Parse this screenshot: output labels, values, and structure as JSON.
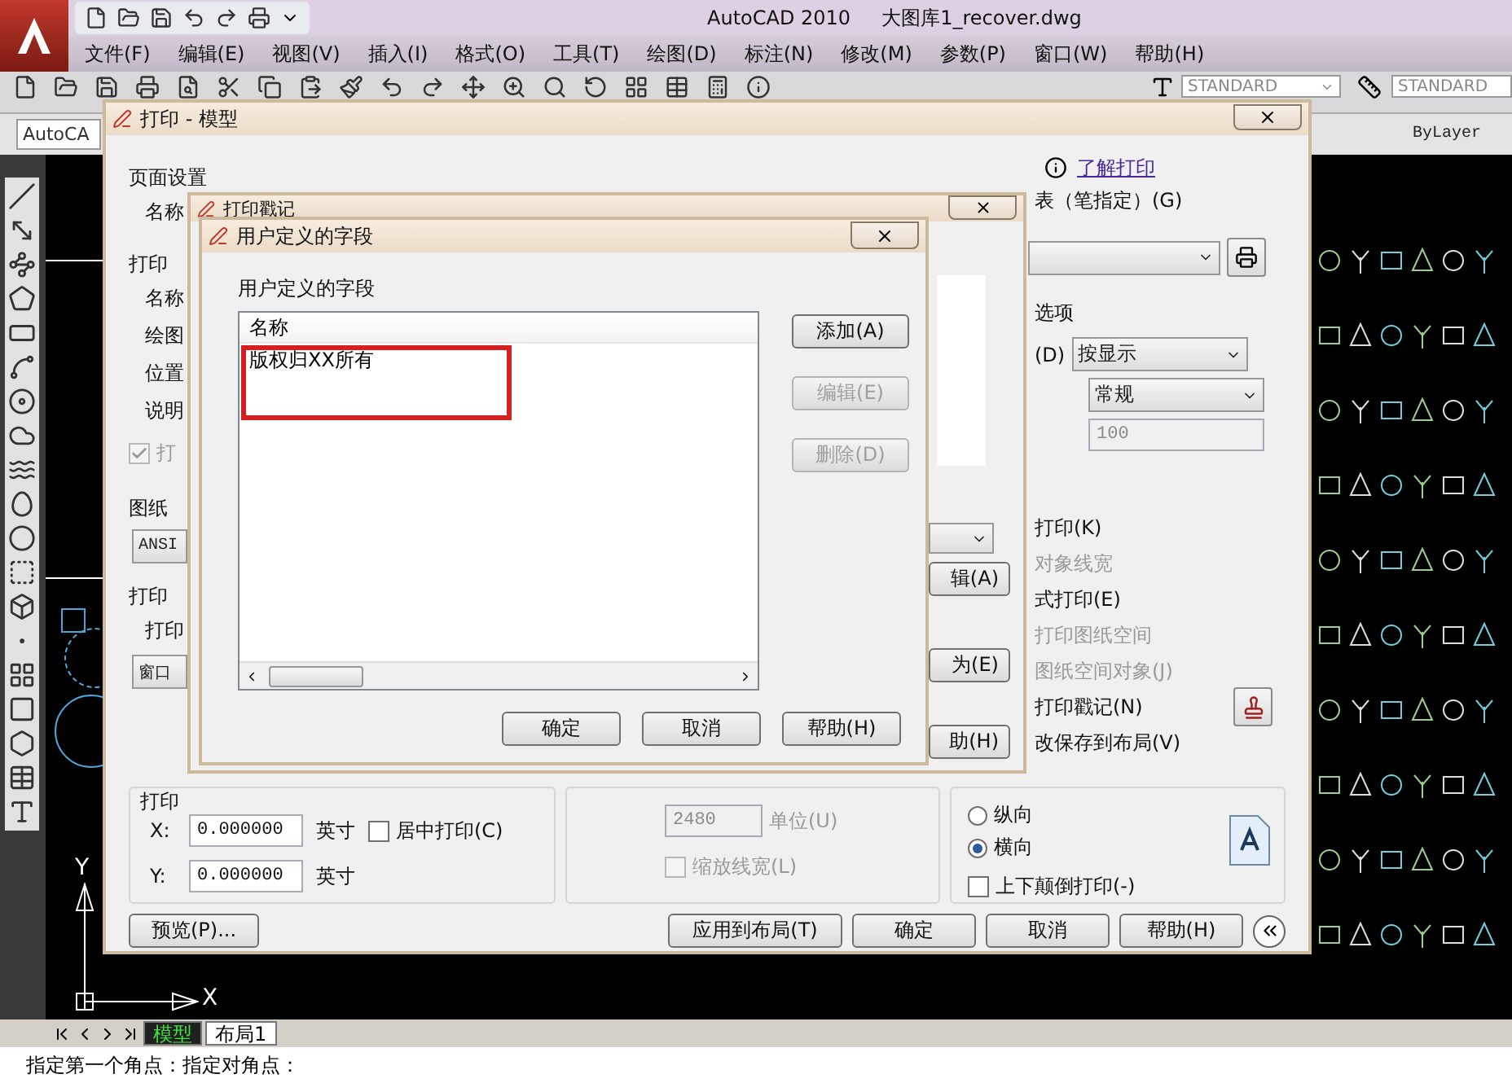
{
  "app": {
    "title": "AutoCAD 2010",
    "file": "大图库1_recover.dwg"
  },
  "menu": [
    "文件(F)",
    "编辑(E)",
    "视图(V)",
    "插入(I)",
    "格式(O)",
    "工具(T)",
    "绘图(D)",
    "标注(N)",
    "修改(M)",
    "参数(P)",
    "窗口(W)",
    "帮助(H)"
  ],
  "toolbar": {
    "text_style": "STANDARD",
    "dim_style": "STANDARD"
  },
  "properties_bar": {
    "workspace": "AutoCA",
    "linetype": "ByLayer"
  },
  "ucs": {
    "x_label": "X",
    "y_label": "Y"
  },
  "layout_tabs": [
    {
      "label": "模型",
      "selected": true
    },
    {
      "label": "布局1",
      "selected": false
    }
  ],
  "command_line": "指定第一个角点：指定对角点：",
  "print_dialog": {
    "title": "打印 - 模型",
    "help_link": "了解打印",
    "left_column": [
      {
        "kind": "group",
        "text": "页面设置"
      },
      {
        "kind": "label",
        "text": "名称"
      },
      {
        "kind": "group",
        "text": "打印"
      },
      {
        "kind": "label",
        "text": "名称"
      },
      {
        "kind": "label",
        "text": "绘图"
      },
      {
        "kind": "label",
        "text": "位置"
      },
      {
        "kind": "label",
        "text": "说明"
      },
      {
        "kind": "checkbox",
        "text": "打",
        "checked": true,
        "disabled": true
      },
      {
        "kind": "group",
        "text": "图纸"
      },
      {
        "kind": "combo",
        "text": "ANSI"
      },
      {
        "kind": "group",
        "text": "打印"
      },
      {
        "kind": "label",
        "text": "打印"
      },
      {
        "kind": "combo",
        "text": "窗口"
      }
    ],
    "plot_style_label": "表（笔指定）(G)",
    "shade_label": "选项",
    "shade_row_label": "(D)",
    "shade_combo": "按显示",
    "quality_combo": "常规",
    "dpi_field": {
      "value": "100",
      "disabled": true
    },
    "options": [
      {
        "kind": "plain",
        "text": "打印(K)",
        "disabled": false
      },
      {
        "kind": "plain",
        "text": "对象线宽",
        "disabled": true
      },
      {
        "kind": "plain",
        "text": "式打印(E)",
        "disabled": false
      },
      {
        "kind": "plain",
        "text": "打印图纸空间",
        "disabled": true
      },
      {
        "kind": "plain",
        "text": "图纸空间对象(J)",
        "disabled": true
      },
      {
        "kind": "stamp",
        "text": "打印戳记(N)",
        "disabled": false
      },
      {
        "kind": "plain",
        "text": "改保存到布局(V)",
        "disabled": false
      }
    ],
    "offset": {
      "title": "打印",
      "x_label": "X:",
      "x_value": "0.000000",
      "x_unit": "英寸",
      "y_label": "Y:",
      "y_value": "0.000000",
      "y_unit": "英寸",
      "center": {
        "label": "居中打印(C)",
        "checked": false
      }
    },
    "scale": {
      "units_value": "2480",
      "units_label": "单位(U)",
      "disabled": true,
      "lineweights": {
        "label": "缩放线宽(L)",
        "checked": false,
        "disabled": true
      }
    },
    "orientation": [
      {
        "label": "纵向",
        "selected": false
      },
      {
        "label": "横向",
        "selected": true
      }
    ],
    "upside_down": {
      "label": "上下颠倒打印(-)",
      "checked": false
    },
    "preview_button": "预览(P)...",
    "buttons": [
      "应用到布局(T)",
      "确定",
      "取消",
      "帮助(H)"
    ]
  },
  "stamp_dialog": {
    "title": "打印戳记",
    "buttons": [
      "辑(A)",
      "为(E)",
      "助(H)"
    ]
  },
  "fields_dialog": {
    "title": "用户定义的字段",
    "group_label": "用户定义的字段",
    "column": "名称",
    "rows": [
      {
        "text": "版权归XX所有",
        "highlighted": true
      }
    ],
    "side_buttons": [
      {
        "label": "添加(A)",
        "disabled": false
      },
      {
        "label": "编辑(E)",
        "disabled": true
      },
      {
        "label": "删除(D)",
        "disabled": true
      }
    ],
    "buttons": [
      "确定",
      "取消",
      "帮助(H)"
    ]
  }
}
